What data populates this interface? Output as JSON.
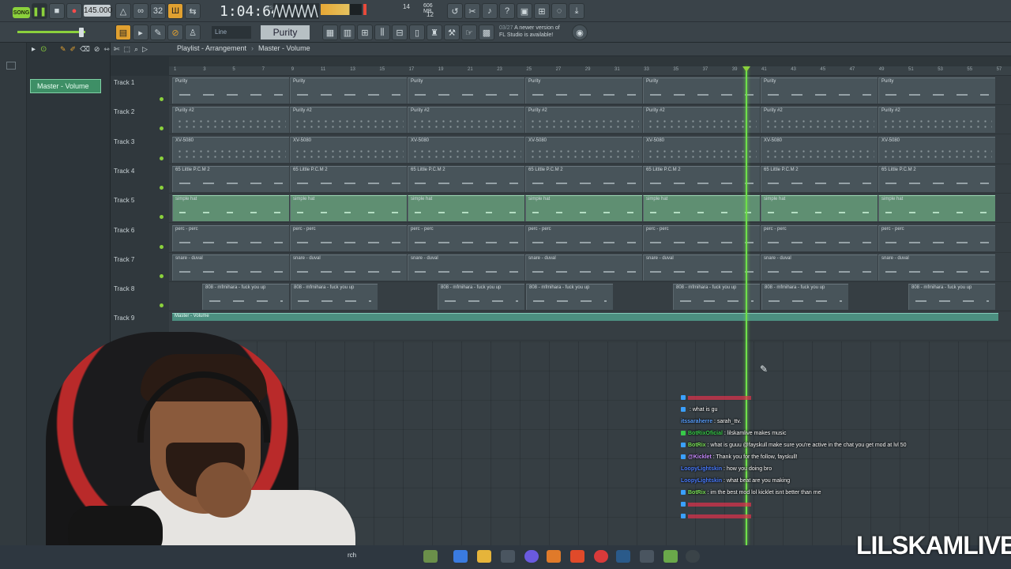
{
  "toolbar": {
    "song_mode": "SONG",
    "tempo": "145.000",
    "time": "1:04:64",
    "time_sub": "M:S:CS",
    "cpu_top": "14",
    "cpu_mem": "606 MB",
    "cpu_bottom": "12",
    "snap": "Line",
    "pattern": "Purity",
    "update_date": "03/27",
    "update_line1": "A newer version of",
    "update_line2": "FL Studio is available!"
  },
  "browser": {
    "selected_item": "Master - Volume"
  },
  "playlist": {
    "title": "Playlist - Arrangement",
    "separator": "›",
    "current": "Master - Volume",
    "bar_numbers": [
      "1",
      "3",
      "5",
      "7",
      "9",
      "11",
      "13",
      "15",
      "17",
      "19",
      "21",
      "23",
      "25",
      "27",
      "29",
      "31",
      "33",
      "35",
      "37",
      "39",
      "41",
      "43",
      "45",
      "47",
      "49",
      "51",
      "53",
      "55",
      "57"
    ],
    "tracks": [
      {
        "label": "Track 1",
        "clip": "Purity"
      },
      {
        "label": "Track 2",
        "clip": "Purity #2"
      },
      {
        "label": "Track 3",
        "clip": "XV-5080"
      },
      {
        "label": "Track 4",
        "clip": "65 Little P.C.M 2"
      },
      {
        "label": "Track 5",
        "clip": "simple hat"
      },
      {
        "label": "Track 6",
        "clip": "perc - perc"
      },
      {
        "label": "Track 7",
        "clip": "snare - duval"
      },
      {
        "label": "Track 8",
        "clip": "808 - mfmihara - fuck you up"
      },
      {
        "label": "Track 9",
        "clip": "Master - Volume"
      }
    ]
  },
  "chat": [
    {
      "user": "",
      "message": "",
      "user_color": "#e0324b",
      "icon_color": "#3aa0ff"
    },
    {
      "user": "",
      "message": "what is gu",
      "user_color": "#e0324b",
      "icon_color": "#3aa0ff"
    },
    {
      "user": "itssaraherre",
      "message": "sarah_ttv.",
      "user_color": "#5aa0ff",
      "icon_color": ""
    },
    {
      "user": "BotRixOficial",
      "message": "lilskamlive makes music",
      "user_color": "#38c94a",
      "icon_color": "#38c94a"
    },
    {
      "user": "BotRix",
      "message": "what is guuu @fayskull make sure you're active in the chat you get mod at lvl 50",
      "user_color": "#7ce35a",
      "icon_color": "#3aa0ff"
    },
    {
      "user": "@Kicklet",
      "message": "Thank you for the follow, fayskull!",
      "user_color": "#c98cff",
      "icon_color": "#3aa0ff"
    },
    {
      "user": "LoopyLightskin",
      "message": "how you doing bro",
      "user_color": "#4a7cff",
      "icon_color": ""
    },
    {
      "user": "LoopyLightskin",
      "message": "what beat are you making",
      "user_color": "#4a7cff",
      "icon_color": ""
    },
    {
      "user": "BotRix",
      "message": "im the best mod lol kicklet isnt better than me",
      "user_color": "#7ce35a",
      "icon_color": "#3aa0ff"
    },
    {
      "user": "",
      "message": "",
      "user_color": "#e0324b",
      "icon_color": "#3aa0ff"
    },
    {
      "user": "",
      "message": "",
      "user_color": "#e0324b",
      "icon_color": "#3aa0ff"
    }
  ],
  "taskbar": {
    "search": "rch"
  },
  "brand": "LILSKAMLIVE"
}
